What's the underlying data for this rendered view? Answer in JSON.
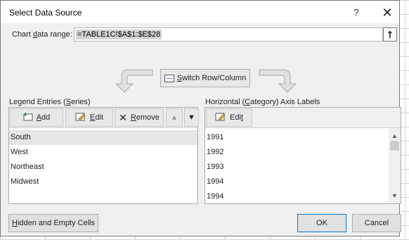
{
  "dialog": {
    "title": "Select Data Source",
    "help_label": "?",
    "close_label": "✕"
  },
  "range": {
    "label": "Chart data range:",
    "value": "=TABLE1C!$A$1:$E$28"
  },
  "switch_label": "Switch Row/Column",
  "legend": {
    "label": "Legend Entries (Series)",
    "add_label": "Add",
    "edit_label": "Edit",
    "remove_label": "Remove",
    "items": [
      "South",
      "West",
      "Northeast",
      "Midwest"
    ]
  },
  "axis": {
    "label": "Horizontal (Category) Axis Labels",
    "edit_label": "Edit",
    "items": [
      "1991",
      "1992",
      "1993",
      "1994",
      "1994"
    ]
  },
  "buttons": {
    "hidden_empty": "Hidden and Empty Cells",
    "ok": "OK",
    "cancel": "Cancel"
  },
  "colors": {
    "accent": "#0078d7",
    "selected_row": "#e5e5e5",
    "range_highlight": "#d3d3d3"
  }
}
